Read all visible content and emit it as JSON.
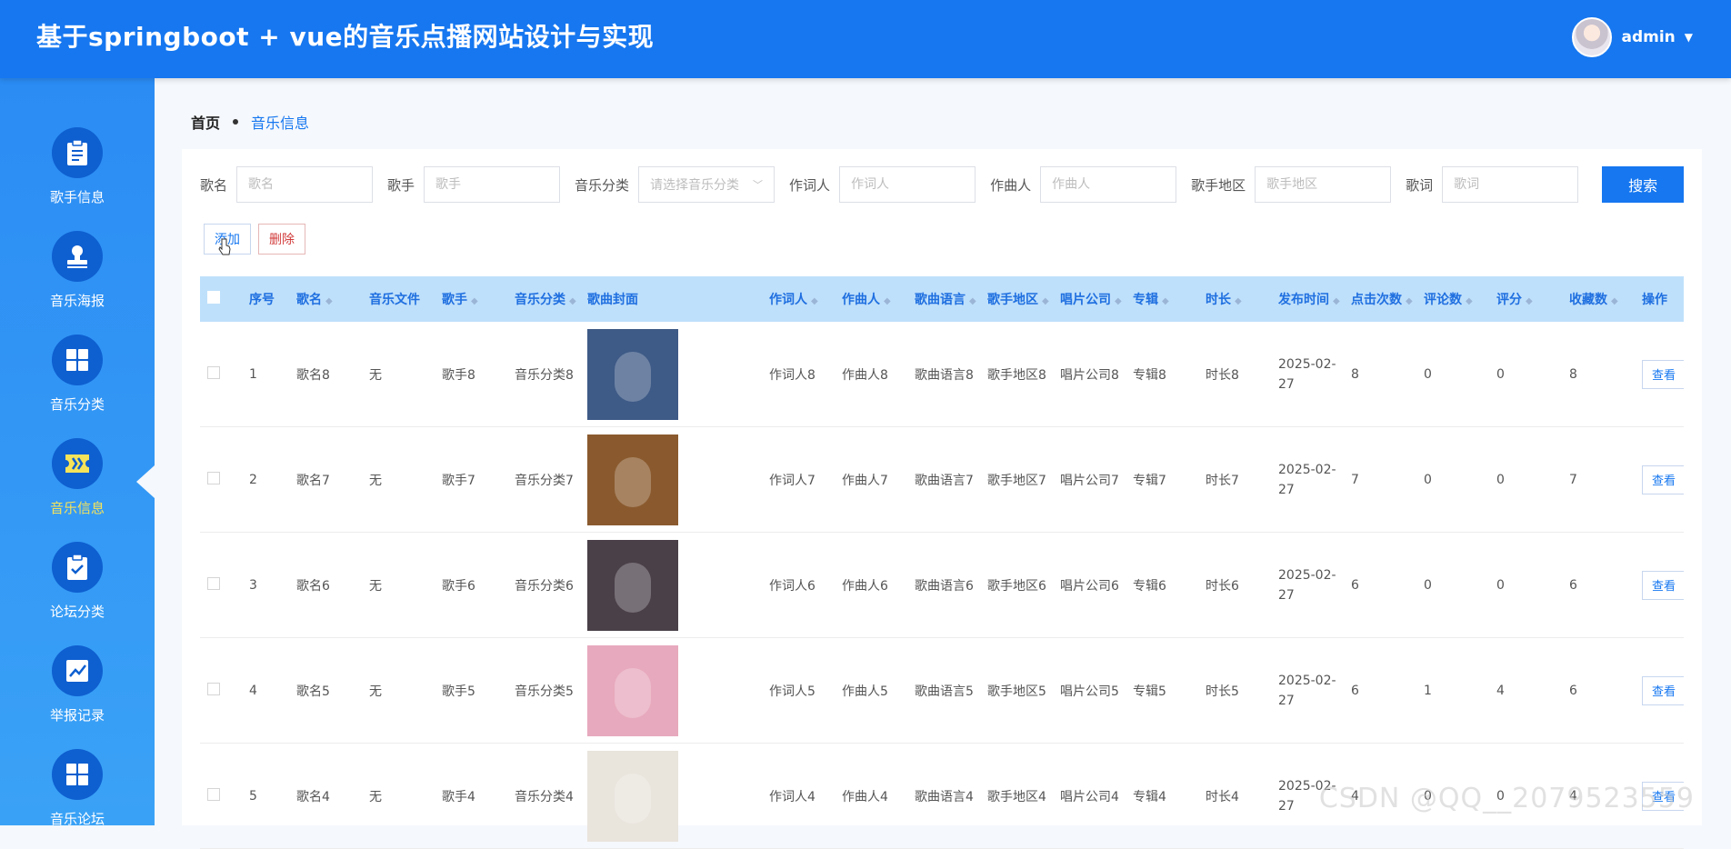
{
  "header": {
    "title": "基于springboot + vue的音乐点播网站设计与实现",
    "user": "admin"
  },
  "sidebar": {
    "items": [
      {
        "label": "歌手信息",
        "icon": "clipboard-icon"
      },
      {
        "label": "音乐海报",
        "icon": "stamp-icon"
      },
      {
        "label": "音乐分类",
        "icon": "grid-icon"
      },
      {
        "label": "音乐信息",
        "icon": "ticket-icon",
        "active": true
      },
      {
        "label": "论坛分类",
        "icon": "clipboard-check-icon"
      },
      {
        "label": "举报记录",
        "icon": "chart-icon"
      },
      {
        "label": "音乐论坛",
        "icon": "grid-icon"
      }
    ]
  },
  "breadcrumb": {
    "home": "首页",
    "current": "音乐信息"
  },
  "search": {
    "song_label": "歌名",
    "song_placeholder": "歌名",
    "singer_label": "歌手",
    "singer_placeholder": "歌手",
    "category_label": "音乐分类",
    "category_placeholder": "请选择音乐分类",
    "lyricist_label": "作词人",
    "lyricist_placeholder": "作词人",
    "composer_label": "作曲人",
    "composer_placeholder": "作曲人",
    "region_label": "歌手地区",
    "region_placeholder": "歌手地区",
    "lyrics_label": "歌词",
    "lyrics_placeholder": "歌词",
    "button": "搜索"
  },
  "actions": {
    "add": "添加",
    "delete": "删除"
  },
  "table": {
    "columns": [
      "序号",
      "歌名",
      "音乐文件",
      "歌手",
      "音乐分类",
      "歌曲封面",
      "作词人",
      "作曲人",
      "歌曲语言",
      "歌手地区",
      "唱片公司",
      "专辑",
      "时长",
      "发布时间",
      "点击次数",
      "评论数",
      "评分",
      "收藏数",
      "操作"
    ],
    "view_label": "查看",
    "rows": [
      {
        "no": "1",
        "song": "歌名8",
        "file": "无",
        "singer": "歌手8",
        "category": "音乐分类8",
        "lyricist": "作词人8",
        "composer": "作曲人8",
        "language": "歌曲语言8",
        "region": "歌手地区8",
        "label": "唱片公司8",
        "album": "专辑8",
        "duration": "时长8",
        "date": "2025-02-27",
        "clicks": "8",
        "comments": "0",
        "score": "0",
        "favs": "8",
        "cover": "#3e5a86"
      },
      {
        "no": "2",
        "song": "歌名7",
        "file": "无",
        "singer": "歌手7",
        "category": "音乐分类7",
        "lyricist": "作词人7",
        "composer": "作曲人7",
        "language": "歌曲语言7",
        "region": "歌手地区7",
        "label": "唱片公司7",
        "album": "专辑7",
        "duration": "时长7",
        "date": "2025-02-27",
        "clicks": "7",
        "comments": "0",
        "score": "0",
        "favs": "7",
        "cover": "#8a5a2e"
      },
      {
        "no": "3",
        "song": "歌名6",
        "file": "无",
        "singer": "歌手6",
        "category": "音乐分类6",
        "lyricist": "作词人6",
        "composer": "作曲人6",
        "language": "歌曲语言6",
        "region": "歌手地区6",
        "label": "唱片公司6",
        "album": "专辑6",
        "duration": "时长6",
        "date": "2025-02-27",
        "clicks": "6",
        "comments": "0",
        "score": "0",
        "favs": "6",
        "cover": "#4a4048"
      },
      {
        "no": "4",
        "song": "歌名5",
        "file": "无",
        "singer": "歌手5",
        "category": "音乐分类5",
        "lyricist": "作词人5",
        "composer": "作曲人5",
        "language": "歌曲语言5",
        "region": "歌手地区5",
        "label": "唱片公司5",
        "album": "专辑5",
        "duration": "时长5",
        "date": "2025-02-27",
        "clicks": "6",
        "comments": "1",
        "score": "4",
        "favs": "6",
        "cover": "#e7a9bd"
      },
      {
        "no": "5",
        "song": "歌名4",
        "file": "无",
        "singer": "歌手4",
        "category": "音乐分类4",
        "lyricist": "作词人4",
        "composer": "作曲人4",
        "language": "歌曲语言4",
        "region": "歌手地区4",
        "label": "唱片公司4",
        "album": "专辑4",
        "duration": "时长4",
        "date": "2025-02-27",
        "clicks": "4",
        "comments": "0",
        "score": "0",
        "favs": "4",
        "cover": "#e9e4dc"
      }
    ]
  },
  "watermark": "CSDN @QQ__2079523559"
}
